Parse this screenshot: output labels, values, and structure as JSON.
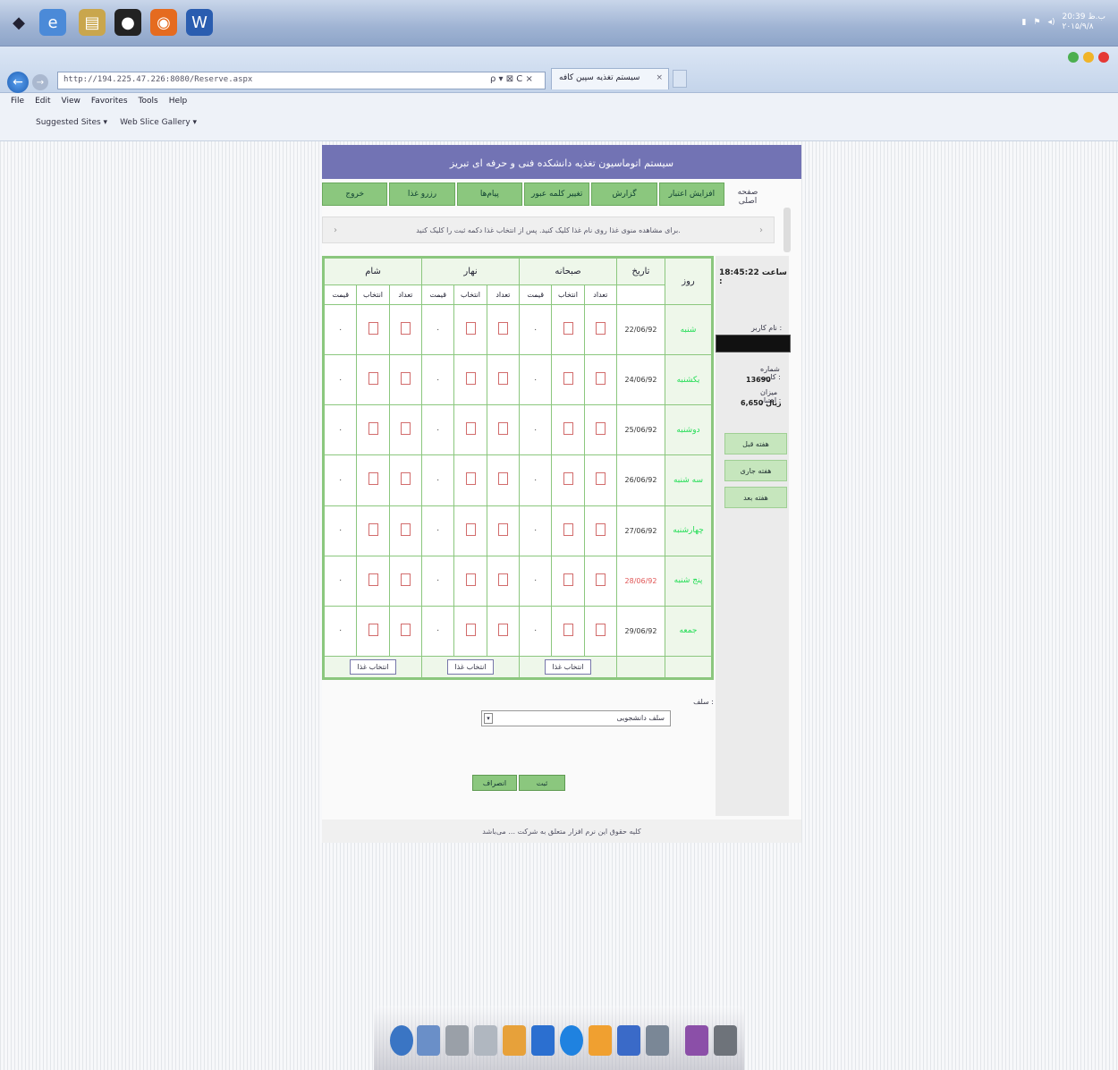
{
  "taskbar": {
    "tray_time": "20:39 ب.ظ",
    "tray_date": "۲۰۱۵/۹/۸"
  },
  "browser": {
    "url": "http://194.225.47.226:8080/Reserve.aspx",
    "tab_title": "سیستم تغذیه سپین کافه",
    "tab_close": "×",
    "menu": [
      "File",
      "Edit",
      "View",
      "Favorites",
      "Tools",
      "Help"
    ],
    "favorites": [
      "Suggested Sites ▾",
      "Web Slice Gallery ▾"
    ],
    "url_tools": "ρ ▾ ⊠ C ×"
  },
  "page": {
    "header_title": "سیستم اتوماسیون تغذیه دانشکده فنی و حرفه ای تبریز",
    "nav": [
      "افزایش اعتبار",
      "گزارش",
      "تغییر کلمه عبور",
      "پیام‌ها",
      "رزرو غذا",
      "خروج"
    ],
    "nav_right": "صفحه اصلی",
    "notice": "برای مشاهده منوی غذا روی نام غذا کلیک کنید. پس از انتخاب غذا دکمه ثبت را کلیک کنید.",
    "notice_arrow": "›",
    "columns": {
      "day": "روز",
      "date": "تاریخ",
      "breakfast": "صبحانه",
      "lunch": "نهار",
      "dinner": "شام",
      "sub_qty": "تعداد",
      "sub_select": "انتخاب",
      "sub_price": "قیمت"
    },
    "rows": [
      {
        "day": "شنبه",
        "date": "22/06/92",
        "holiday": false
      },
      {
        "day": "یکشنبه",
        "date": "24/06/92",
        "holiday": false
      },
      {
        "day": "دوشنبه",
        "date": "25/06/92",
        "holiday": false
      },
      {
        "day": "سه شنبه",
        "date": "26/06/92",
        "holiday": false
      },
      {
        "day": "چهارشنبه",
        "date": "27/06/92",
        "holiday": false
      },
      {
        "day": "پنج شنبه",
        "date": "28/06/92",
        "holiday": true
      },
      {
        "day": "جمعه",
        "date": "29/06/92",
        "holiday": false
      }
    ],
    "qty_value": "۰",
    "meal_button": "انتخاب غذا",
    "side": {
      "clock_label": "ساعت :",
      "clock_value": "18:45:22",
      "name_label": "نام کاربر :",
      "credit_label": "شماره کارت :",
      "credit_value": "13690",
      "balance_label": "میزان اعتبار :",
      "balance_value": "6,650 ریال",
      "buttons": [
        "هفته قبل",
        "هفته جاری",
        "هفته بعد"
      ]
    },
    "form": {
      "kiosk_label": "سلف :",
      "kiosk_value": "سلف دانشجویی",
      "kiosk_caret": "▾",
      "save": "ثبت",
      "cancel": "انصراف"
    },
    "footer": "کلیه حقوق این نرم افزار متعلق به شرکت ... می‌باشد"
  },
  "colors": {
    "header": "#7273b4",
    "nav": "#8bc77e",
    "border_green": "#8bc77e",
    "holiday_red": "#e05555"
  }
}
